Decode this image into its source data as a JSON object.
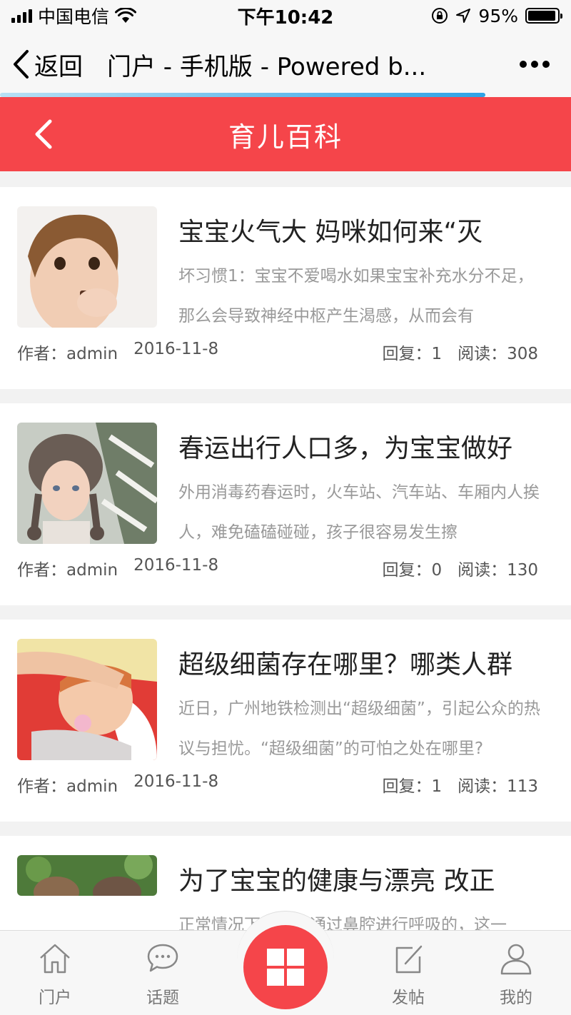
{
  "status_bar": {
    "carrier": "中国电信",
    "time": "下午10:42",
    "battery_percent": "95%",
    "battery_level": 0.95
  },
  "browser": {
    "back_label": "返回",
    "title": "门户 - 手机版 - Powered b...",
    "load_progress": 0.85
  },
  "header": {
    "title": "育儿百科"
  },
  "articles": [
    {
      "title": "宝宝火气大 妈咪如何来“灭",
      "summary": "坏习惯1：宝宝不爱喝水如果宝宝补充水分不足，那么会导致神经中枢产生渴感，从而会有",
      "author": "作者：admin",
      "date": "2016-11-8",
      "replies": "回复：1",
      "reads": "阅读：308"
    },
    {
      "title": "春运出行人口多，为宝宝做好",
      "summary": "外用消毒药春运时，火车站、汽车站、车厢内人挨人，难免磕磕碰碰，孩子很容易发生擦",
      "author": "作者：admin",
      "date": "2016-11-8",
      "replies": "回复：0",
      "reads": "阅读：130"
    },
    {
      "title": "超级细菌存在哪里？哪类人群",
      "summary": "近日，广州地铁检测出“超级细菌”，引起公众的热议与担忧。“超级细菌”的可怕之处在哪里?",
      "author": "作者：admin",
      "date": "2016-11-8",
      "replies": "回复：1",
      "reads": "阅读：113"
    },
    {
      "title": "为了宝宝的健康与漂亮 改正",
      "summary": "正常情况下，人是通过鼻腔进行呼吸的，这一"
    }
  ],
  "tabbar": {
    "home": "门户",
    "topics": "话题",
    "post": "发帖",
    "mine": "我的"
  },
  "colors": {
    "accent": "#f5454a",
    "progress": "#2ea3e6"
  }
}
